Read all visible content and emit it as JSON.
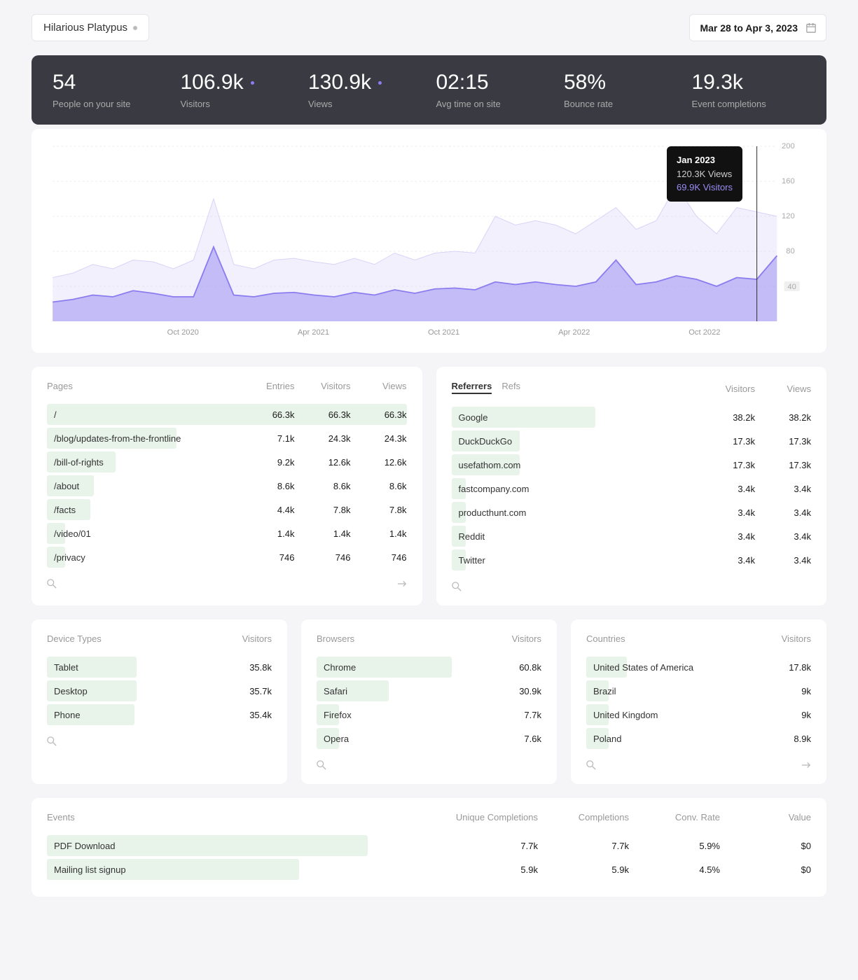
{
  "site_name": "Hilarious Platypus",
  "date_range": "Mar 28 to Apr 3, 2023",
  "stats": [
    {
      "value": "54",
      "label": "People on your site",
      "dot": false
    },
    {
      "value": "106.9k",
      "label": "Visitors",
      "dot": true
    },
    {
      "value": "130.9k",
      "label": "Views",
      "dot": true
    },
    {
      "value": "02:15",
      "label": "Avg time on site",
      "dot": false
    },
    {
      "value": "58%",
      "label": "Bounce rate",
      "dot": false
    },
    {
      "value": "19.3k",
      "label": "Event completions",
      "dot": false
    }
  ],
  "chart_data": {
    "type": "area",
    "xlabels": [
      "Oct 2020",
      "Apr 2021",
      "Oct 2021",
      "Apr 2022",
      "Oct 2022"
    ],
    "ylabel": "",
    "ylim": [
      0,
      200
    ],
    "yticks": [
      40,
      80,
      120,
      160,
      200
    ],
    "series": [
      {
        "name": "Views",
        "color": "#d9d3f7",
        "values": [
          50,
          55,
          65,
          60,
          70,
          68,
          60,
          70,
          140,
          65,
          60,
          70,
          72,
          68,
          65,
          72,
          65,
          78,
          70,
          78,
          80,
          78,
          120,
          110,
          115,
          110,
          100,
          115,
          130,
          105,
          115,
          155,
          120,
          100,
          130,
          125,
          120
        ]
      },
      {
        "name": "Visitors",
        "color": "#8b7cf0",
        "values": [
          22,
          25,
          30,
          28,
          35,
          32,
          28,
          28,
          85,
          30,
          28,
          32,
          33,
          30,
          28,
          33,
          30,
          36,
          32,
          37,
          38,
          36,
          45,
          42,
          45,
          42,
          40,
          45,
          70,
          42,
          45,
          52,
          48,
          40,
          50,
          48,
          75
        ]
      }
    ],
    "tooltip": {
      "date": "Jan 2023",
      "views": "120.3K Views",
      "visitors": "69.9K Visitors"
    }
  },
  "pages": {
    "title": "Pages",
    "cols": [
      "Entries",
      "Visitors",
      "Views"
    ],
    "rows": [
      {
        "label": "/",
        "vals": [
          "66.3k",
          "66.3k",
          "66.3k"
        ],
        "bar": 100
      },
      {
        "label": "/blog/updates-from-the-frontline",
        "vals": [
          "7.1k",
          "24.3k",
          "24.3k"
        ],
        "bar": 36
      },
      {
        "label": "/bill-of-rights",
        "vals": [
          "9.2k",
          "12.6k",
          "12.6k"
        ],
        "bar": 19
      },
      {
        "label": "/about",
        "vals": [
          "8.6k",
          "8.6k",
          "8.6k"
        ],
        "bar": 13
      },
      {
        "label": "/facts",
        "vals": [
          "4.4k",
          "7.8k",
          "7.8k"
        ],
        "bar": 12
      },
      {
        "label": "/video/01",
        "vals": [
          "1.4k",
          "1.4k",
          "1.4k"
        ],
        "bar": 5
      },
      {
        "label": "/privacy",
        "vals": [
          "746",
          "746",
          "746"
        ],
        "bar": 5
      }
    ]
  },
  "referrers": {
    "tabs": [
      "Referrers",
      "Refs"
    ],
    "cols": [
      "Visitors",
      "Views"
    ],
    "rows": [
      {
        "label": "Google",
        "vals": [
          "38.2k",
          "38.2k"
        ],
        "bar": 40
      },
      {
        "label": "DuckDuckGo",
        "vals": [
          "17.3k",
          "17.3k"
        ],
        "bar": 19
      },
      {
        "label": "usefathom.com",
        "vals": [
          "17.3k",
          "17.3k"
        ],
        "bar": 19
      },
      {
        "label": "fastcompany.com",
        "vals": [
          "3.4k",
          "3.4k"
        ],
        "bar": 4
      },
      {
        "label": "producthunt.com",
        "vals": [
          "3.4k",
          "3.4k"
        ],
        "bar": 4
      },
      {
        "label": "Reddit",
        "vals": [
          "3.4k",
          "3.4k"
        ],
        "bar": 4
      },
      {
        "label": "Twitter",
        "vals": [
          "3.4k",
          "3.4k"
        ],
        "bar": 4
      }
    ]
  },
  "devices": {
    "title": "Device Types",
    "cols": [
      "Visitors"
    ],
    "rows": [
      {
        "label": "Tablet",
        "vals": [
          "35.8k"
        ],
        "bar": 40
      },
      {
        "label": "Desktop",
        "vals": [
          "35.7k"
        ],
        "bar": 40
      },
      {
        "label": "Phone",
        "vals": [
          "35.4k"
        ],
        "bar": 39
      }
    ]
  },
  "browsers": {
    "title": "Browsers",
    "cols": [
      "Visitors"
    ],
    "rows": [
      {
        "label": "Chrome",
        "vals": [
          "60.8k"
        ],
        "bar": 60
      },
      {
        "label": "Safari",
        "vals": [
          "30.9k"
        ],
        "bar": 32
      },
      {
        "label": "Firefox",
        "vals": [
          "7.7k"
        ],
        "bar": 10
      },
      {
        "label": "Opera",
        "vals": [
          "7.6k"
        ],
        "bar": 10
      }
    ]
  },
  "countries": {
    "title": "Countries",
    "cols": [
      "Visitors"
    ],
    "rows": [
      {
        "label": "United States of America",
        "vals": [
          "17.8k"
        ],
        "bar": 18
      },
      {
        "label": "Brazil",
        "vals": [
          "9k"
        ],
        "bar": 10
      },
      {
        "label": "United Kingdom",
        "vals": [
          "9k"
        ],
        "bar": 10
      },
      {
        "label": "Poland",
        "vals": [
          "8.9k"
        ],
        "bar": 10
      }
    ]
  },
  "events": {
    "title": "Events",
    "cols": [
      "Unique Completions",
      "Completions",
      "Conv. Rate",
      "Value"
    ],
    "rows": [
      {
        "label": "PDF Download",
        "vals": [
          "7.7k",
          "7.7k",
          "5.9%",
          "$0"
        ],
        "bar": 42
      },
      {
        "label": "Mailing list signup",
        "vals": [
          "5.9k",
          "5.9k",
          "4.5%",
          "$0"
        ],
        "bar": 33
      }
    ]
  }
}
